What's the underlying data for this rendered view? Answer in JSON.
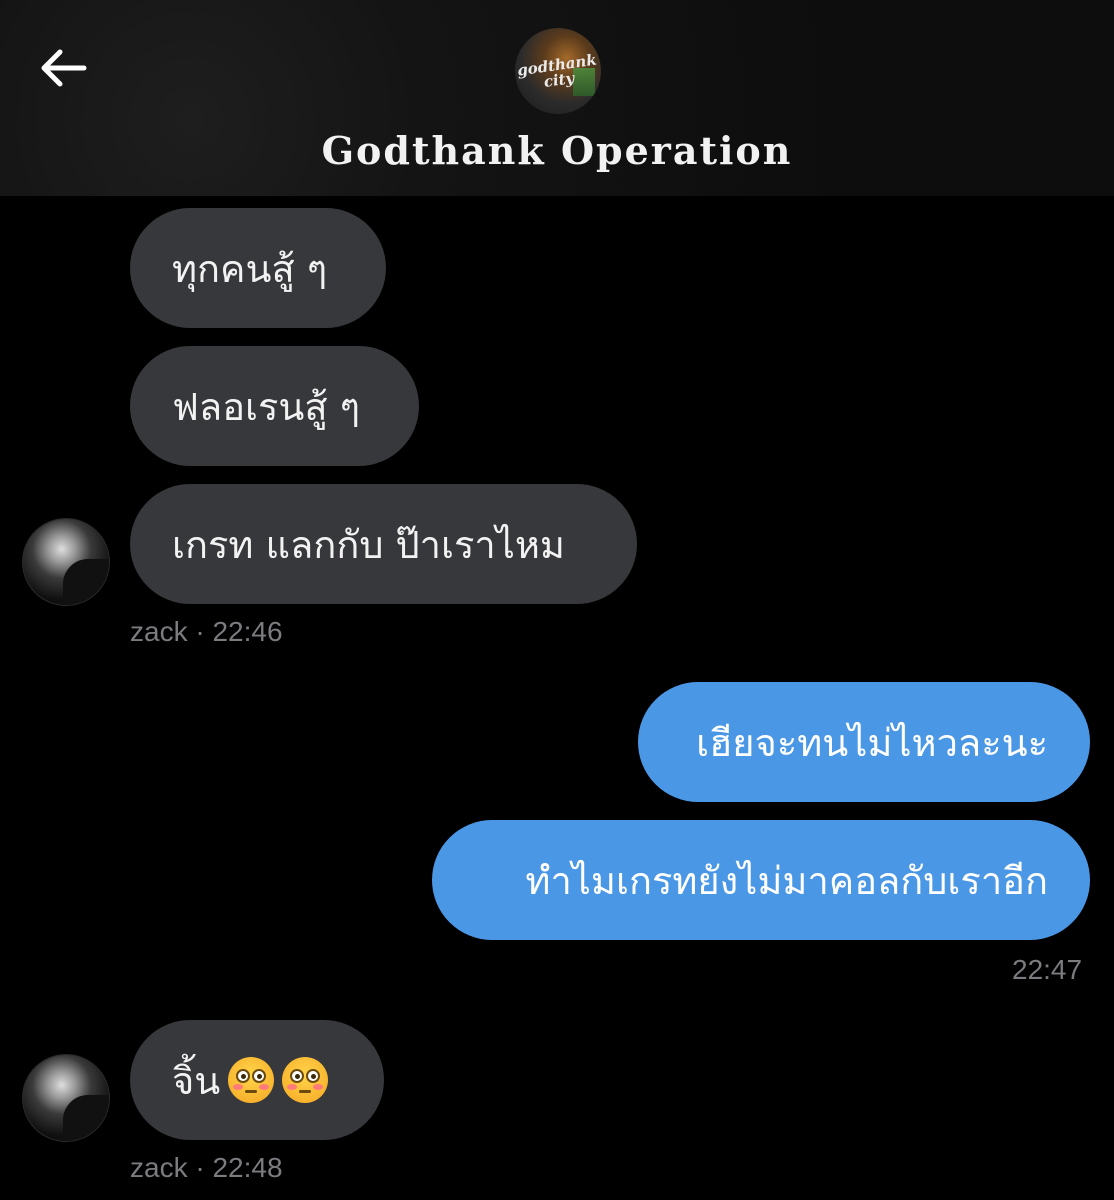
{
  "header": {
    "title": "Godthank Operation",
    "avatar_logo_text": "godthank city"
  },
  "messages": [
    {
      "sender": "zack",
      "text": "ทุกคนสู้ ๆ"
    },
    {
      "sender": "zack",
      "text": "ฟลอเรนสู้ ๆ"
    },
    {
      "sender": "zack",
      "text": "เกรท แลกกับ ป๊าเราไหม"
    },
    {
      "sender": "me",
      "text": "เฮียจะทนไม่ไหวละนะ"
    },
    {
      "sender": "me",
      "text": "ทำไมเกรทยังไม่มาคอลกับเราอีก"
    },
    {
      "sender": "zack",
      "text": "จิ้น"
    }
  ],
  "meta": {
    "group1_name": "zack",
    "group1_time": "· 22:46",
    "group2_time": "22:47",
    "group3_name": "zack",
    "group3_time": "· 22:48"
  },
  "icons": {
    "back": "arrow-left-icon",
    "emoji": "flushed-face-emoji"
  },
  "colors": {
    "background": "#000000",
    "incoming_bubble": "#37383b",
    "outgoing_bubble": "#4a97e6",
    "meta_text": "#7b7b80"
  }
}
